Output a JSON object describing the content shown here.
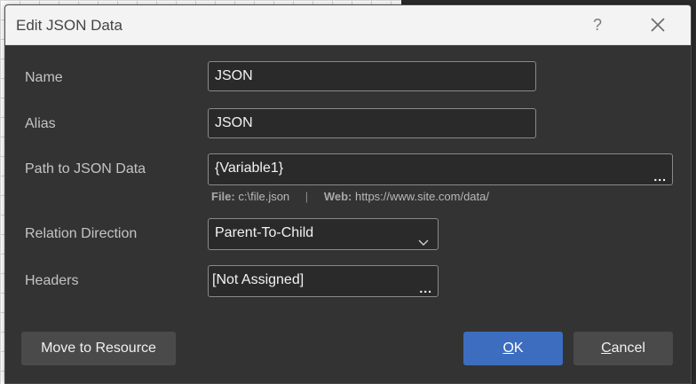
{
  "dialog": {
    "title": "Edit JSON Data",
    "help_glyph": "?"
  },
  "form": {
    "name_label": "Name",
    "name_value": "JSON",
    "alias_label": "Alias",
    "alias_value": "JSON",
    "path_label": "Path to JSON Data",
    "path_value": "{Variable1}",
    "path_hint": {
      "file_key": "File:",
      "file_value": "c:\\file.json",
      "separator": "|",
      "web_key": "Web:",
      "web_value": "https://www.site.com/data/"
    },
    "relation_label": "Relation Direction",
    "relation_value": "Parent-To-Child",
    "headers_label": "Headers",
    "headers_value": "[Not Assigned]",
    "browse_glyph": "..."
  },
  "buttons": {
    "move_label": "Move to Resource",
    "ok_underlined": "O",
    "ok_rest": "K",
    "cancel_underlined": "C",
    "cancel_rest": "ancel"
  },
  "icons": {
    "help": "help-icon",
    "close": "close-icon",
    "dropdown": "chevron-down-icon",
    "browse": "ellipsis-icon"
  },
  "colors": {
    "dialog_bg": "#333333",
    "titlebar_bg": "#f3f3f3",
    "accent": "#3d6dbf"
  }
}
